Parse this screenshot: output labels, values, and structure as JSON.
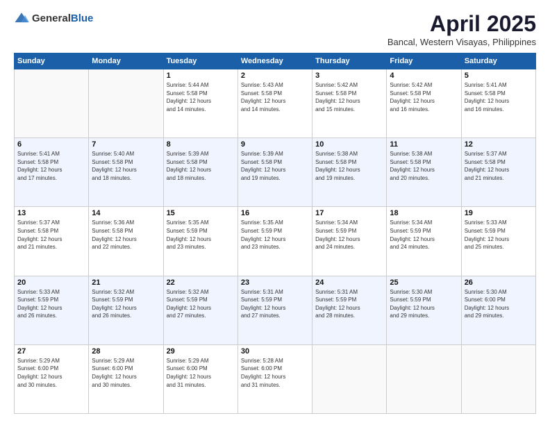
{
  "logo": {
    "general": "General",
    "blue": "Blue"
  },
  "header": {
    "month": "April 2025",
    "location": "Bancal, Western Visayas, Philippines"
  },
  "weekdays": [
    "Sunday",
    "Monday",
    "Tuesday",
    "Wednesday",
    "Thursday",
    "Friday",
    "Saturday"
  ],
  "weeks": [
    [
      {
        "day": "",
        "info": ""
      },
      {
        "day": "",
        "info": ""
      },
      {
        "day": "1",
        "info": "Sunrise: 5:44 AM\nSunset: 5:58 PM\nDaylight: 12 hours\nand 14 minutes."
      },
      {
        "day": "2",
        "info": "Sunrise: 5:43 AM\nSunset: 5:58 PM\nDaylight: 12 hours\nand 14 minutes."
      },
      {
        "day": "3",
        "info": "Sunrise: 5:42 AM\nSunset: 5:58 PM\nDaylight: 12 hours\nand 15 minutes."
      },
      {
        "day": "4",
        "info": "Sunrise: 5:42 AM\nSunset: 5:58 PM\nDaylight: 12 hours\nand 16 minutes."
      },
      {
        "day": "5",
        "info": "Sunrise: 5:41 AM\nSunset: 5:58 PM\nDaylight: 12 hours\nand 16 minutes."
      }
    ],
    [
      {
        "day": "6",
        "info": "Sunrise: 5:41 AM\nSunset: 5:58 PM\nDaylight: 12 hours\nand 17 minutes."
      },
      {
        "day": "7",
        "info": "Sunrise: 5:40 AM\nSunset: 5:58 PM\nDaylight: 12 hours\nand 18 minutes."
      },
      {
        "day": "8",
        "info": "Sunrise: 5:39 AM\nSunset: 5:58 PM\nDaylight: 12 hours\nand 18 minutes."
      },
      {
        "day": "9",
        "info": "Sunrise: 5:39 AM\nSunset: 5:58 PM\nDaylight: 12 hours\nand 19 minutes."
      },
      {
        "day": "10",
        "info": "Sunrise: 5:38 AM\nSunset: 5:58 PM\nDaylight: 12 hours\nand 19 minutes."
      },
      {
        "day": "11",
        "info": "Sunrise: 5:38 AM\nSunset: 5:58 PM\nDaylight: 12 hours\nand 20 minutes."
      },
      {
        "day": "12",
        "info": "Sunrise: 5:37 AM\nSunset: 5:58 PM\nDaylight: 12 hours\nand 21 minutes."
      }
    ],
    [
      {
        "day": "13",
        "info": "Sunrise: 5:37 AM\nSunset: 5:58 PM\nDaylight: 12 hours\nand 21 minutes."
      },
      {
        "day": "14",
        "info": "Sunrise: 5:36 AM\nSunset: 5:58 PM\nDaylight: 12 hours\nand 22 minutes."
      },
      {
        "day": "15",
        "info": "Sunrise: 5:35 AM\nSunset: 5:59 PM\nDaylight: 12 hours\nand 23 minutes."
      },
      {
        "day": "16",
        "info": "Sunrise: 5:35 AM\nSunset: 5:59 PM\nDaylight: 12 hours\nand 23 minutes."
      },
      {
        "day": "17",
        "info": "Sunrise: 5:34 AM\nSunset: 5:59 PM\nDaylight: 12 hours\nand 24 minutes."
      },
      {
        "day": "18",
        "info": "Sunrise: 5:34 AM\nSunset: 5:59 PM\nDaylight: 12 hours\nand 24 minutes."
      },
      {
        "day": "19",
        "info": "Sunrise: 5:33 AM\nSunset: 5:59 PM\nDaylight: 12 hours\nand 25 minutes."
      }
    ],
    [
      {
        "day": "20",
        "info": "Sunrise: 5:33 AM\nSunset: 5:59 PM\nDaylight: 12 hours\nand 26 minutes."
      },
      {
        "day": "21",
        "info": "Sunrise: 5:32 AM\nSunset: 5:59 PM\nDaylight: 12 hours\nand 26 minutes."
      },
      {
        "day": "22",
        "info": "Sunrise: 5:32 AM\nSunset: 5:59 PM\nDaylight: 12 hours\nand 27 minutes."
      },
      {
        "day": "23",
        "info": "Sunrise: 5:31 AM\nSunset: 5:59 PM\nDaylight: 12 hours\nand 27 minutes."
      },
      {
        "day": "24",
        "info": "Sunrise: 5:31 AM\nSunset: 5:59 PM\nDaylight: 12 hours\nand 28 minutes."
      },
      {
        "day": "25",
        "info": "Sunrise: 5:30 AM\nSunset: 5:59 PM\nDaylight: 12 hours\nand 29 minutes."
      },
      {
        "day": "26",
        "info": "Sunrise: 5:30 AM\nSunset: 6:00 PM\nDaylight: 12 hours\nand 29 minutes."
      }
    ],
    [
      {
        "day": "27",
        "info": "Sunrise: 5:29 AM\nSunset: 6:00 PM\nDaylight: 12 hours\nand 30 minutes."
      },
      {
        "day": "28",
        "info": "Sunrise: 5:29 AM\nSunset: 6:00 PM\nDaylight: 12 hours\nand 30 minutes."
      },
      {
        "day": "29",
        "info": "Sunrise: 5:29 AM\nSunset: 6:00 PM\nDaylight: 12 hours\nand 31 minutes."
      },
      {
        "day": "30",
        "info": "Sunrise: 5:28 AM\nSunset: 6:00 PM\nDaylight: 12 hours\nand 31 minutes."
      },
      {
        "day": "",
        "info": ""
      },
      {
        "day": "",
        "info": ""
      },
      {
        "day": "",
        "info": ""
      }
    ]
  ]
}
